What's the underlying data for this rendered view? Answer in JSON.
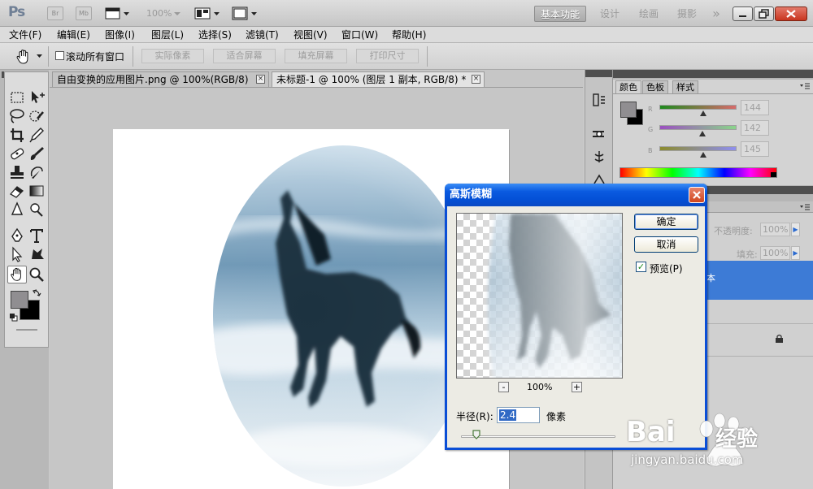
{
  "app": {
    "logo": "Ps",
    "chips": [
      "Br",
      "Mb"
    ],
    "zoom": "100%",
    "workspaces": [
      "基本功能",
      "设计",
      "绘画",
      "摄影"
    ],
    "more": "»"
  },
  "menu": [
    "文件(F)",
    "编辑(E)",
    "图像(I)",
    "图层(L)",
    "选择(S)",
    "滤镜(T)",
    "视图(V)",
    "窗口(W)",
    "帮助(H)"
  ],
  "options": {
    "scroll_all": "滚动所有窗口",
    "buttons": [
      "实际像素",
      "适合屏幕",
      "填充屏幕",
      "打印尺寸"
    ]
  },
  "tabs": [
    {
      "label": "自由变换的应用图片.png @ 100%(RGB/8)",
      "close": "×"
    },
    {
      "label": "未标题-1 @ 100% (图层 1 副本, RGB/8) *",
      "close": "×"
    }
  ],
  "color_panel": {
    "tabs": [
      "颜色",
      "色板",
      "样式"
    ],
    "channels": [
      {
        "label": "R",
        "value": "144",
        "level": 0.565
      },
      {
        "label": "G",
        "value": "142",
        "level": 0.557
      },
      {
        "label": "B",
        "value": "145",
        "level": 0.569
      }
    ],
    "colors": {
      "fg": "#908e91",
      "bg": "#000000",
      "r_track": "#d76b6b",
      "g_track": "#9b4fc0",
      "b_track": "#8c8c2c"
    }
  },
  "layers_panel": {
    "opacity_label": "不透明度:",
    "opacity_value": "100%",
    "fill_label": "填充:",
    "fill_value": "100%",
    "selected_layer_fragment": "本"
  },
  "dialog": {
    "title": "高斯模糊",
    "ok": "确定",
    "cancel": "取消",
    "preview_label": "预览(P)",
    "preview_checked": true,
    "zoom_out": "-",
    "zoom_level": "100%",
    "zoom_in": "+",
    "radius_label": "半径(R):",
    "radius_value": "2.4",
    "radius_unit": "像素",
    "radius_level": 0.1
  },
  "watermark": {
    "brand": "Bai",
    "brand_suffix": "经验",
    "url": "jingyan.baidu.com"
  }
}
